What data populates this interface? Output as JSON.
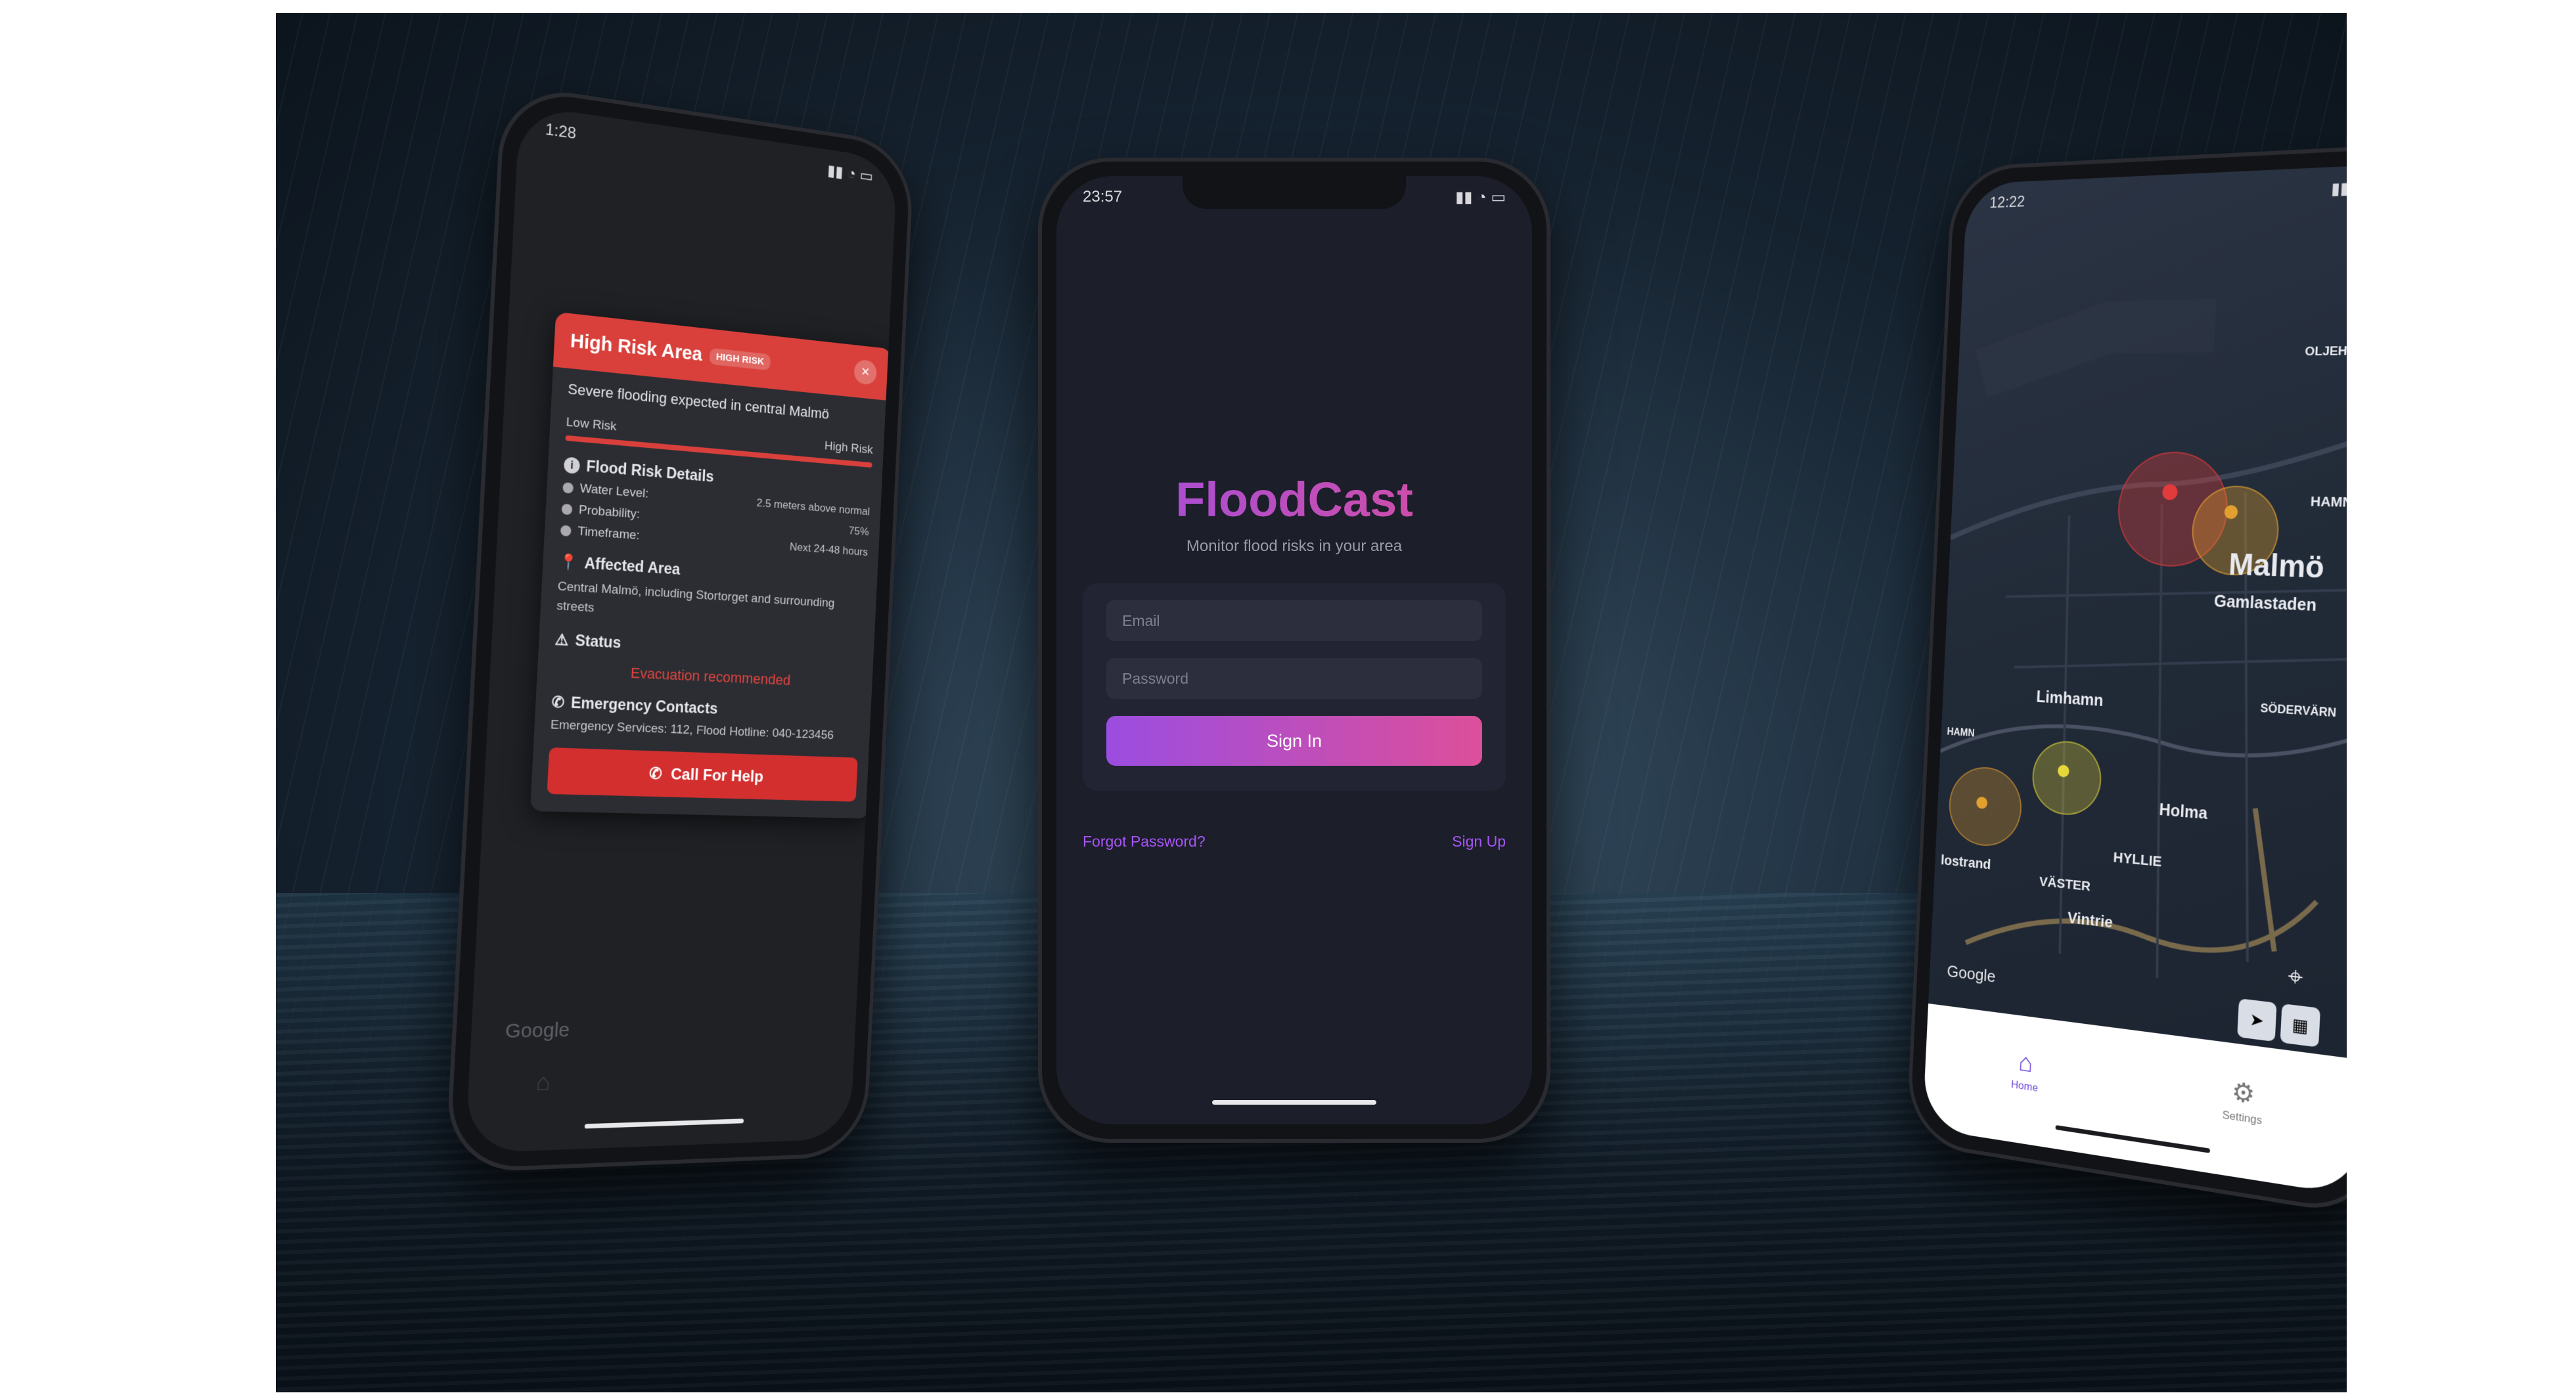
{
  "left_phone": {
    "status_time": "1:28",
    "modal": {
      "title": "High Risk Area",
      "badge": "HIGH RISK",
      "description": "Severe flooding expected in central Malmö",
      "risk_low_label": "Low Risk",
      "risk_high_label": "High Risk",
      "details_title": "Flood Risk Details",
      "details": [
        {
          "label": "Water Level:",
          "value": "2.5 meters above normal"
        },
        {
          "label": "Probability:",
          "value": "75%"
        },
        {
          "label": "Timeframe:",
          "value": "Next 24-48 hours"
        }
      ],
      "area_title": "Affected Area",
      "area_text": "Central Malmö, including Stortorget and surrounding streets",
      "status_title": "Status",
      "status_value": "Evacuation recommended",
      "contacts_title": "Emergency Contacts",
      "contacts_text": "Emergency Services: 112, Flood Hotline: 040-123456",
      "cta_label": "Call For Help"
    },
    "map_google": "Google"
  },
  "center_phone": {
    "status_time": "23:57",
    "app_name": "FloodCast",
    "tagline": "Monitor flood risks in your area",
    "email_placeholder": "Email",
    "password_placeholder": "Password",
    "signin_label": "Sign In",
    "forgot_label": "Forgot Password?",
    "signup_label": "Sign Up",
    "colors": {
      "brand_start": "#9b4de0",
      "brand_end": "#dd4f9a"
    }
  },
  "right_phone": {
    "status_time": "12:22",
    "map_labels": {
      "oljehamn": "OLJEHAMN",
      "hamnen": "HAMNEN",
      "malmo": "Malmö",
      "gamlastaden": "Gamlastaden",
      "limhamn": "Limhamn",
      "sodervarn": "SÖDERVÄRN",
      "hamn": "HAMN",
      "holma": "Holma",
      "hyllie": "HYLLIE",
      "bunkeflostrand": "lostrand",
      "vaster": "VÄSTER",
      "vintrie": "Vintrie",
      "google": "Google"
    },
    "tabs": [
      {
        "label": "Home",
        "icon": "home-icon"
      },
      {
        "label": "Settings",
        "icon": "gear-icon"
      }
    ],
    "pin_colors": {
      "high": "#e23b3b",
      "medium": "#e3a02f",
      "low": "#e6d83a"
    }
  }
}
